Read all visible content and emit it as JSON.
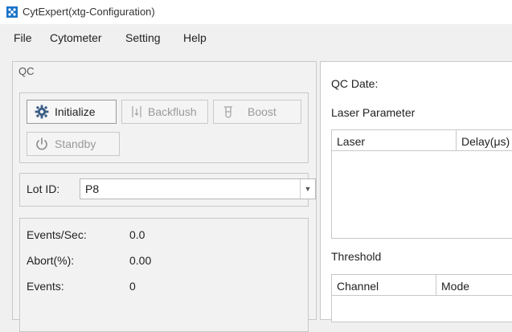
{
  "window": {
    "title": "CytExpert(xtg-Configuration)",
    "icon": "app-logo-icon"
  },
  "menu": [
    {
      "label": "File"
    },
    {
      "label": "Cytometer"
    },
    {
      "label": "Setting"
    },
    {
      "label": "Help"
    }
  ],
  "qc": {
    "title": "QC",
    "buttons": {
      "initialize": "Initialize",
      "backflush": "Backflush",
      "boost": "Boost",
      "standby": "Standby"
    },
    "lot_label": "Lot ID:",
    "lot_value": "P8",
    "stats": [
      {
        "label": "Events/Sec:",
        "value": "0.0"
      },
      {
        "label": "Abort(%):",
        "value": "0.00"
      },
      {
        "label": "Events:",
        "value": "0"
      }
    ]
  },
  "right": {
    "qc_date_label": "QC Date:",
    "laser_parameter_label": "Laser Parameter",
    "laser_table_headers": [
      "Laser",
      "Delay(μs)"
    ],
    "threshold_label": "Threshold",
    "threshold_table_headers": [
      "Channel",
      "Mode"
    ]
  },
  "colors": {
    "app_icon": "#1a73c9",
    "panel_bg": "#f2f2f2",
    "border": "#c8c8c8"
  }
}
